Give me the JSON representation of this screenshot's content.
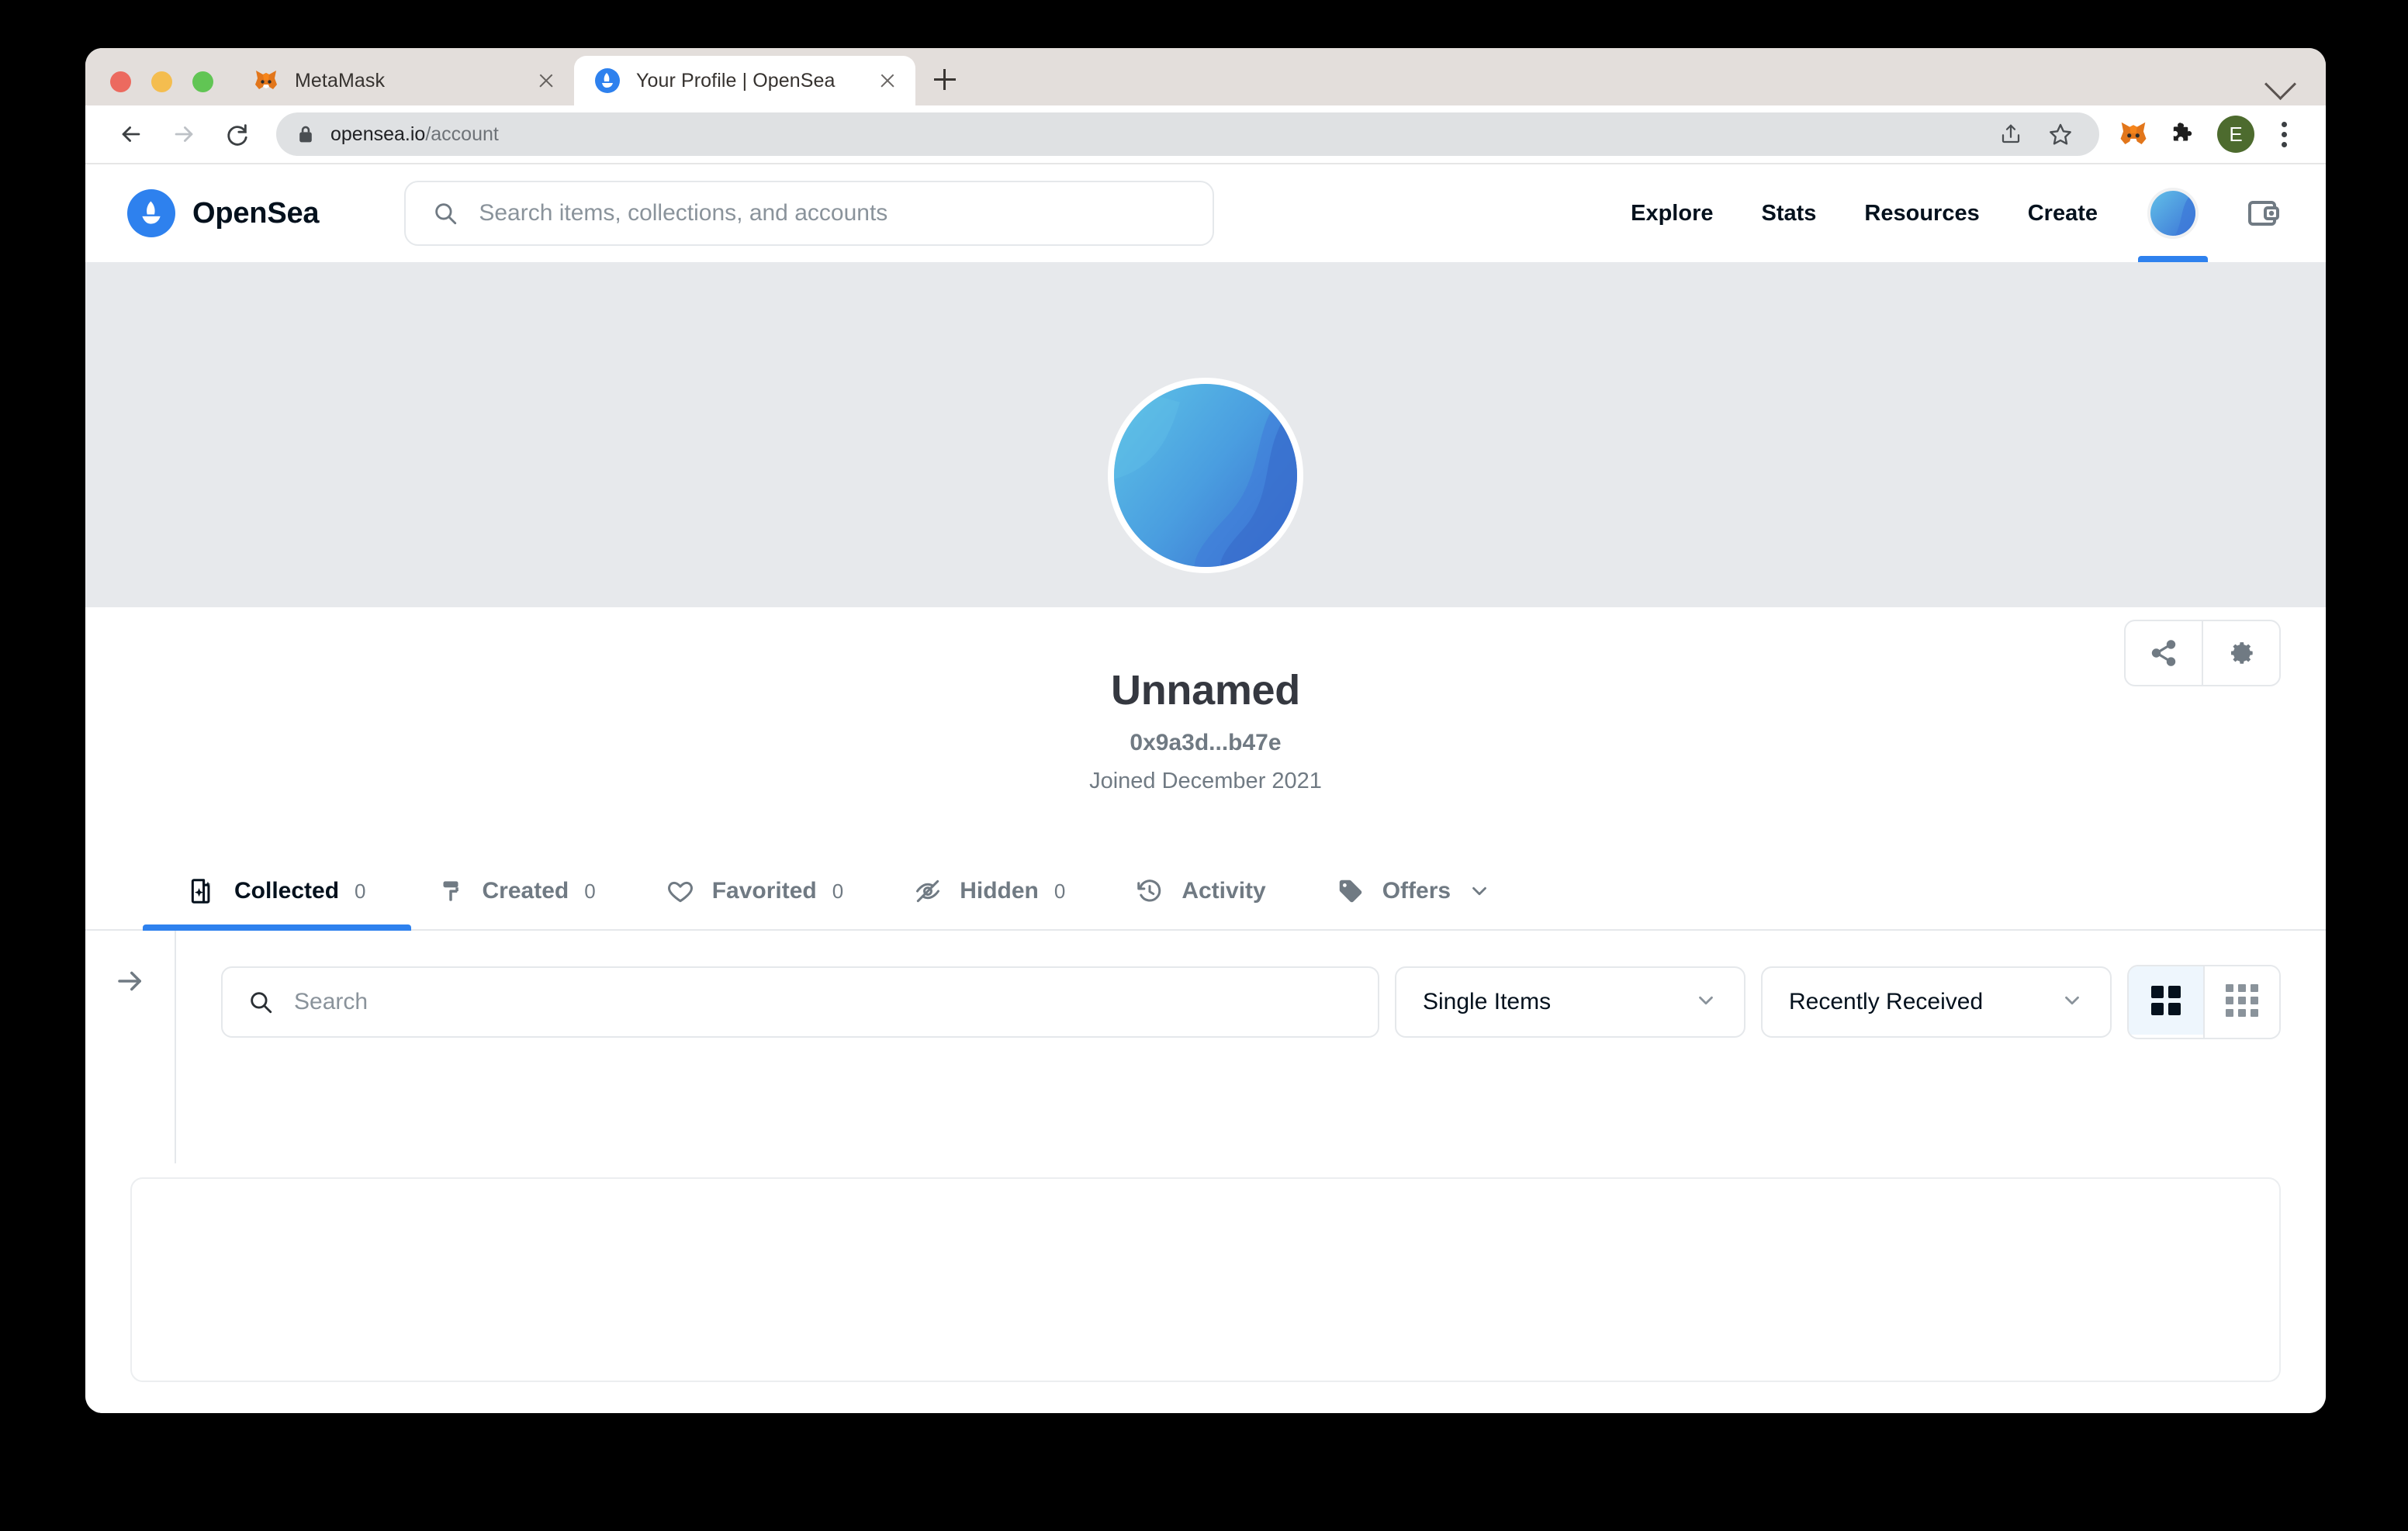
{
  "browser": {
    "tabs": [
      {
        "title": "MetaMask",
        "favicon": "metamask-fox-icon",
        "active": false
      },
      {
        "title": "Your Profile | OpenSea",
        "favicon": "opensea-icon",
        "active": true
      }
    ],
    "new_tab_label": "+",
    "toolbar": {
      "back_icon": "back-arrow-icon",
      "forward_icon": "forward-arrow-icon",
      "reload_icon": "reload-icon",
      "lock_icon": "lock-icon",
      "url_domain": "opensea.io",
      "url_path": "/account",
      "share_icon": "share-icon",
      "bookmark_icon": "star-icon",
      "metamask_icon": "metamask-fox-icon",
      "extensions_icon": "puzzle-piece-icon",
      "profile_initial": "E",
      "menu_icon": "kebab-menu-icon"
    }
  },
  "site": {
    "brand": {
      "name": "OpenSea",
      "logo": "opensea-ship-icon"
    },
    "search": {
      "placeholder": "Search items, collections, and accounts",
      "icon": "search-icon",
      "value": ""
    },
    "nav": [
      {
        "label": "Explore"
      },
      {
        "label": "Stats"
      },
      {
        "label": "Resources"
      },
      {
        "label": "Create"
      }
    ],
    "account_avatar": "profile-avatar-icon",
    "wallet_icon": "wallet-icon"
  },
  "profile": {
    "name": "Unnamed",
    "address": "0x9a3d...b47e",
    "joined": "Joined December 2021",
    "actions": [
      {
        "name": "share",
        "icon": "share-icon"
      },
      {
        "name": "settings",
        "icon": "gear-icon"
      }
    ]
  },
  "content_tabs": [
    {
      "label": "Collected",
      "count": "0",
      "icon": "collected-icon",
      "active": true
    },
    {
      "label": "Created",
      "count": "0",
      "icon": "paint-roller-icon",
      "active": false
    },
    {
      "label": "Favorited",
      "count": "0",
      "icon": "heart-icon",
      "active": false
    },
    {
      "label": "Hidden",
      "count": "0",
      "icon": "eye-off-icon",
      "active": false
    },
    {
      "label": "Activity",
      "count": "",
      "icon": "history-clock-icon",
      "active": false
    },
    {
      "label": "Offers",
      "count": "",
      "icon": "price-tag-icon",
      "active": false,
      "chevron": "chevron-down-icon"
    }
  ],
  "filters": {
    "expand_icon": "arrow-right-icon",
    "search": {
      "placeholder": "Search",
      "icon": "search-icon",
      "value": ""
    },
    "type_select": {
      "value": "Single Items",
      "chevron": "chevron-down-icon"
    },
    "sort_select": {
      "value": "Recently Received",
      "chevron": "chevron-down-icon"
    },
    "view_toggle": [
      {
        "name": "grid-large-view",
        "icon": "grid-2x2-icon",
        "active": true
      },
      {
        "name": "grid-small-view",
        "icon": "grid-3x3-icon",
        "active": false
      }
    ]
  },
  "colors": {
    "brand_blue": "#2e81ee",
    "banner_gray": "#e7e9ec",
    "text_dark": "#04111d",
    "text_muted": "#707a83",
    "border": "#e5e8eb"
  }
}
